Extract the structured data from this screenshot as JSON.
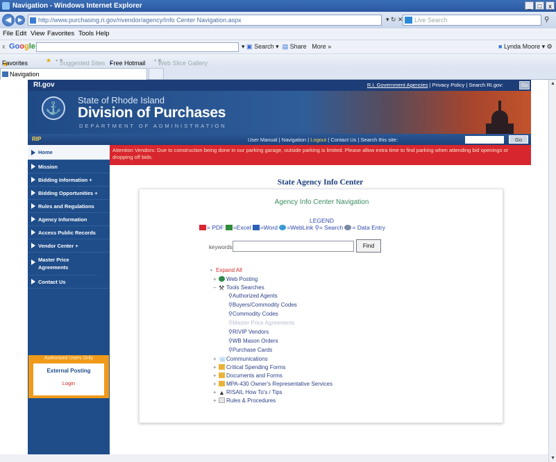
{
  "browser": {
    "title": "Navigation - Windows Internet Explorer",
    "address_url": "http://www.purchasing.ri.gov/rivendor/agency/Info Center Navigation.aspx",
    "search_placeholder": "Live Search",
    "window_controls": [
      "_",
      "□",
      "x"
    ],
    "menu": [
      "File",
      "Edit",
      "View",
      "Favorites",
      "Tools",
      "Help"
    ],
    "google": {
      "close": "x",
      "logo": [
        "Go",
        "o",
        "g",
        "le"
      ],
      "search_label": "Search",
      "share_label": "Share",
      "more_label": "More »",
      "user": "Lynda Moore"
    },
    "favorites": {
      "label": "Favorites",
      "items": [
        "Suggested Sites",
        "Free Hotmail",
        "Web Slice Gallery"
      ]
    },
    "tab": "Navigation"
  },
  "site": {
    "logo": "RI.gov",
    "toplinks": [
      "R.I. Government Agencies",
      "Privacy Policy",
      "Search RI.gov:"
    ],
    "topgo": "Go",
    "banner": {
      "state": "State of Rhode Island",
      "division": "Division of Purchases",
      "dept": "DEPARTMENT OF ADMINISTRATION"
    },
    "navbar": {
      "rip": "RIP",
      "user_manual": "User Manual",
      "navigation": "Navigation",
      "logout": "Logout",
      "contact_us": "Contact Us",
      "search_label": "Search this site:",
      "go": "Go"
    },
    "sidebar": {
      "items": [
        {
          "label": "Home"
        },
        {
          "label": "Mission"
        },
        {
          "label": "Bidding Information +"
        },
        {
          "label": "Bidding Opportunities +"
        },
        {
          "label": "Rules and Regulations"
        },
        {
          "label": "Agency Information"
        },
        {
          "label": "Access Public Records"
        },
        {
          "label": "Vendor Center +"
        },
        {
          "label": "Master Price Agreements"
        },
        {
          "label": "Contact Us"
        }
      ],
      "auth_header": "Authorized Users Only",
      "external_posting": "External Posting",
      "login": "Login"
    },
    "alert": "Attention Vendors: Due to construction being done in our parking garage, outside parking is limited. Please allow extra time to find parking when attending bid openings or dropping off bids.",
    "main_title": "State Agency Info Center",
    "panel": {
      "title": "Agency Info Center Navigation",
      "legend_header": "LEGEND",
      "legend": [
        "= PDF",
        "=Excel",
        "=Word",
        "=WebLink",
        "= Search",
        "= Data Entry"
      ],
      "keywords_label": "keywords",
      "keywords_value": "",
      "find_label": "Find",
      "expand_all": "Expand All",
      "tree": [
        {
          "label": "Web Posting",
          "level": 0,
          "sign": "+",
          "icon": "globe-icon"
        },
        {
          "label": "Tools Searches",
          "level": 0,
          "sign": "–",
          "icon": "tools-icon"
        },
        {
          "label": "Authorized Agents",
          "level": 1,
          "icon": "search-icon"
        },
        {
          "label": "Buyers/Commodity Codes",
          "level": 1,
          "icon": "search-icon"
        },
        {
          "label": "Commodity Codes",
          "level": 1,
          "icon": "search-icon"
        },
        {
          "label": "Master Price Agreements",
          "level": 1,
          "icon": "search-icon",
          "dim": true
        },
        {
          "label": "RIVIP Vendors",
          "level": 1,
          "icon": "search-icon"
        },
        {
          "label": "WB Mason Orders",
          "level": 1,
          "icon": "search-icon"
        },
        {
          "label": "Purchase Cards",
          "level": 1,
          "icon": "search-icon"
        },
        {
          "label": "Communications",
          "level": 0,
          "sign": "+",
          "icon": "communications-icon"
        },
        {
          "label": "Critical Spending Forms",
          "level": 0,
          "sign": "+",
          "icon": "folder-icon"
        },
        {
          "label": "Documents and Forms",
          "level": 0,
          "sign": "+",
          "icon": "folder-icon"
        },
        {
          "label": "MPA-430 Owner's Representative Services",
          "level": 0,
          "sign": "+",
          "icon": "folder-icon"
        },
        {
          "label": "RISAIL How To's / Tips",
          "level": 0,
          "sign": "+",
          "icon": "pyramid-icon"
        },
        {
          "label": "Rules & Procedures",
          "level": 0,
          "sign": "+",
          "icon": "document-icon"
        }
      ]
    }
  },
  "colors": {
    "site_blue": "#1f4d8a",
    "alert_red": "#d8262f",
    "auth_orange": "#f09a1a",
    "tree_link": "#2b3f86",
    "panel_title_green": "#3a8a5e"
  }
}
